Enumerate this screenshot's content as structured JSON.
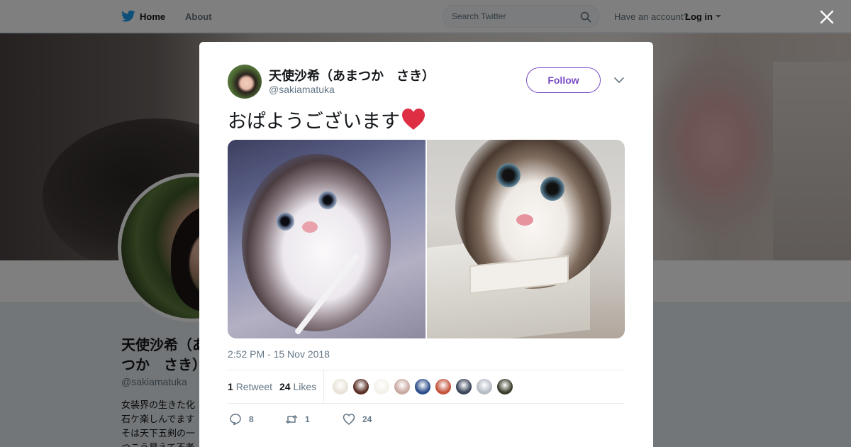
{
  "topbar": {
    "home_label": "Home",
    "about_label": "About",
    "search_placeholder": "Search Twitter",
    "account_prompt": "Have an account?",
    "login_label": "Log in"
  },
  "profile": {
    "name": "天使沙希（あまつか　さき）",
    "handle": "@sakiamatuka",
    "bio": "女装界の生きた化石ケ楽しんでます そは天下五剣の一つこう見えて不老不"
  },
  "tweet": {
    "author_name": "天使沙希（あまつか　さき）",
    "author_handle": "@sakiamatuka",
    "follow_label": "Follow",
    "text": "おぱようございます",
    "emoji": "heart-emoji",
    "timestamp": "2:52 PM - 15 Nov 2018",
    "retweet_count": "1",
    "retweet_label": "Retweet",
    "like_count": "24",
    "like_label": "Likes",
    "reply_action_count": "8",
    "retweet_action_count": "1",
    "like_action_count": "24"
  },
  "likers": [
    {
      "color": "#e9e2d8"
    },
    {
      "color": "#5a2f26"
    },
    {
      "color": "#f4f1ea"
    },
    {
      "color": "#c9a9a2"
    },
    {
      "color": "#2b4e8c"
    },
    {
      "color": "#c4533a"
    },
    {
      "color": "#3a4358"
    },
    {
      "color": "#b6bcc4"
    },
    {
      "color": "#3b3d2c"
    }
  ],
  "colors": {
    "accent": "#794bc4",
    "twitter_blue": "#1da1f2",
    "heart": "#e0245e"
  }
}
